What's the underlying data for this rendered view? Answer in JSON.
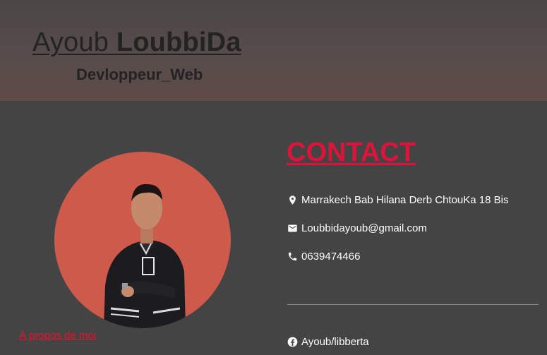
{
  "header": {
    "first_name": "Ayoub",
    "last_name": "LoubbiDa",
    "role": "Devloppeur_Web"
  },
  "profile": {
    "avatar_icon": "person-photo",
    "about_link": "À propos de moi"
  },
  "contact": {
    "title": "CONTACT",
    "address": "Marrakech Bab Hilana Derb ChtouKa 18 Bis",
    "email": "Loubbidayoub@gmail.com",
    "phone": "0639474466",
    "facebook": "Ayoub/libberta"
  },
  "colors": {
    "background": "#454444",
    "accent": "#dc143c",
    "avatar_bg": "#cd5a4b",
    "header_text": "#232323"
  }
}
